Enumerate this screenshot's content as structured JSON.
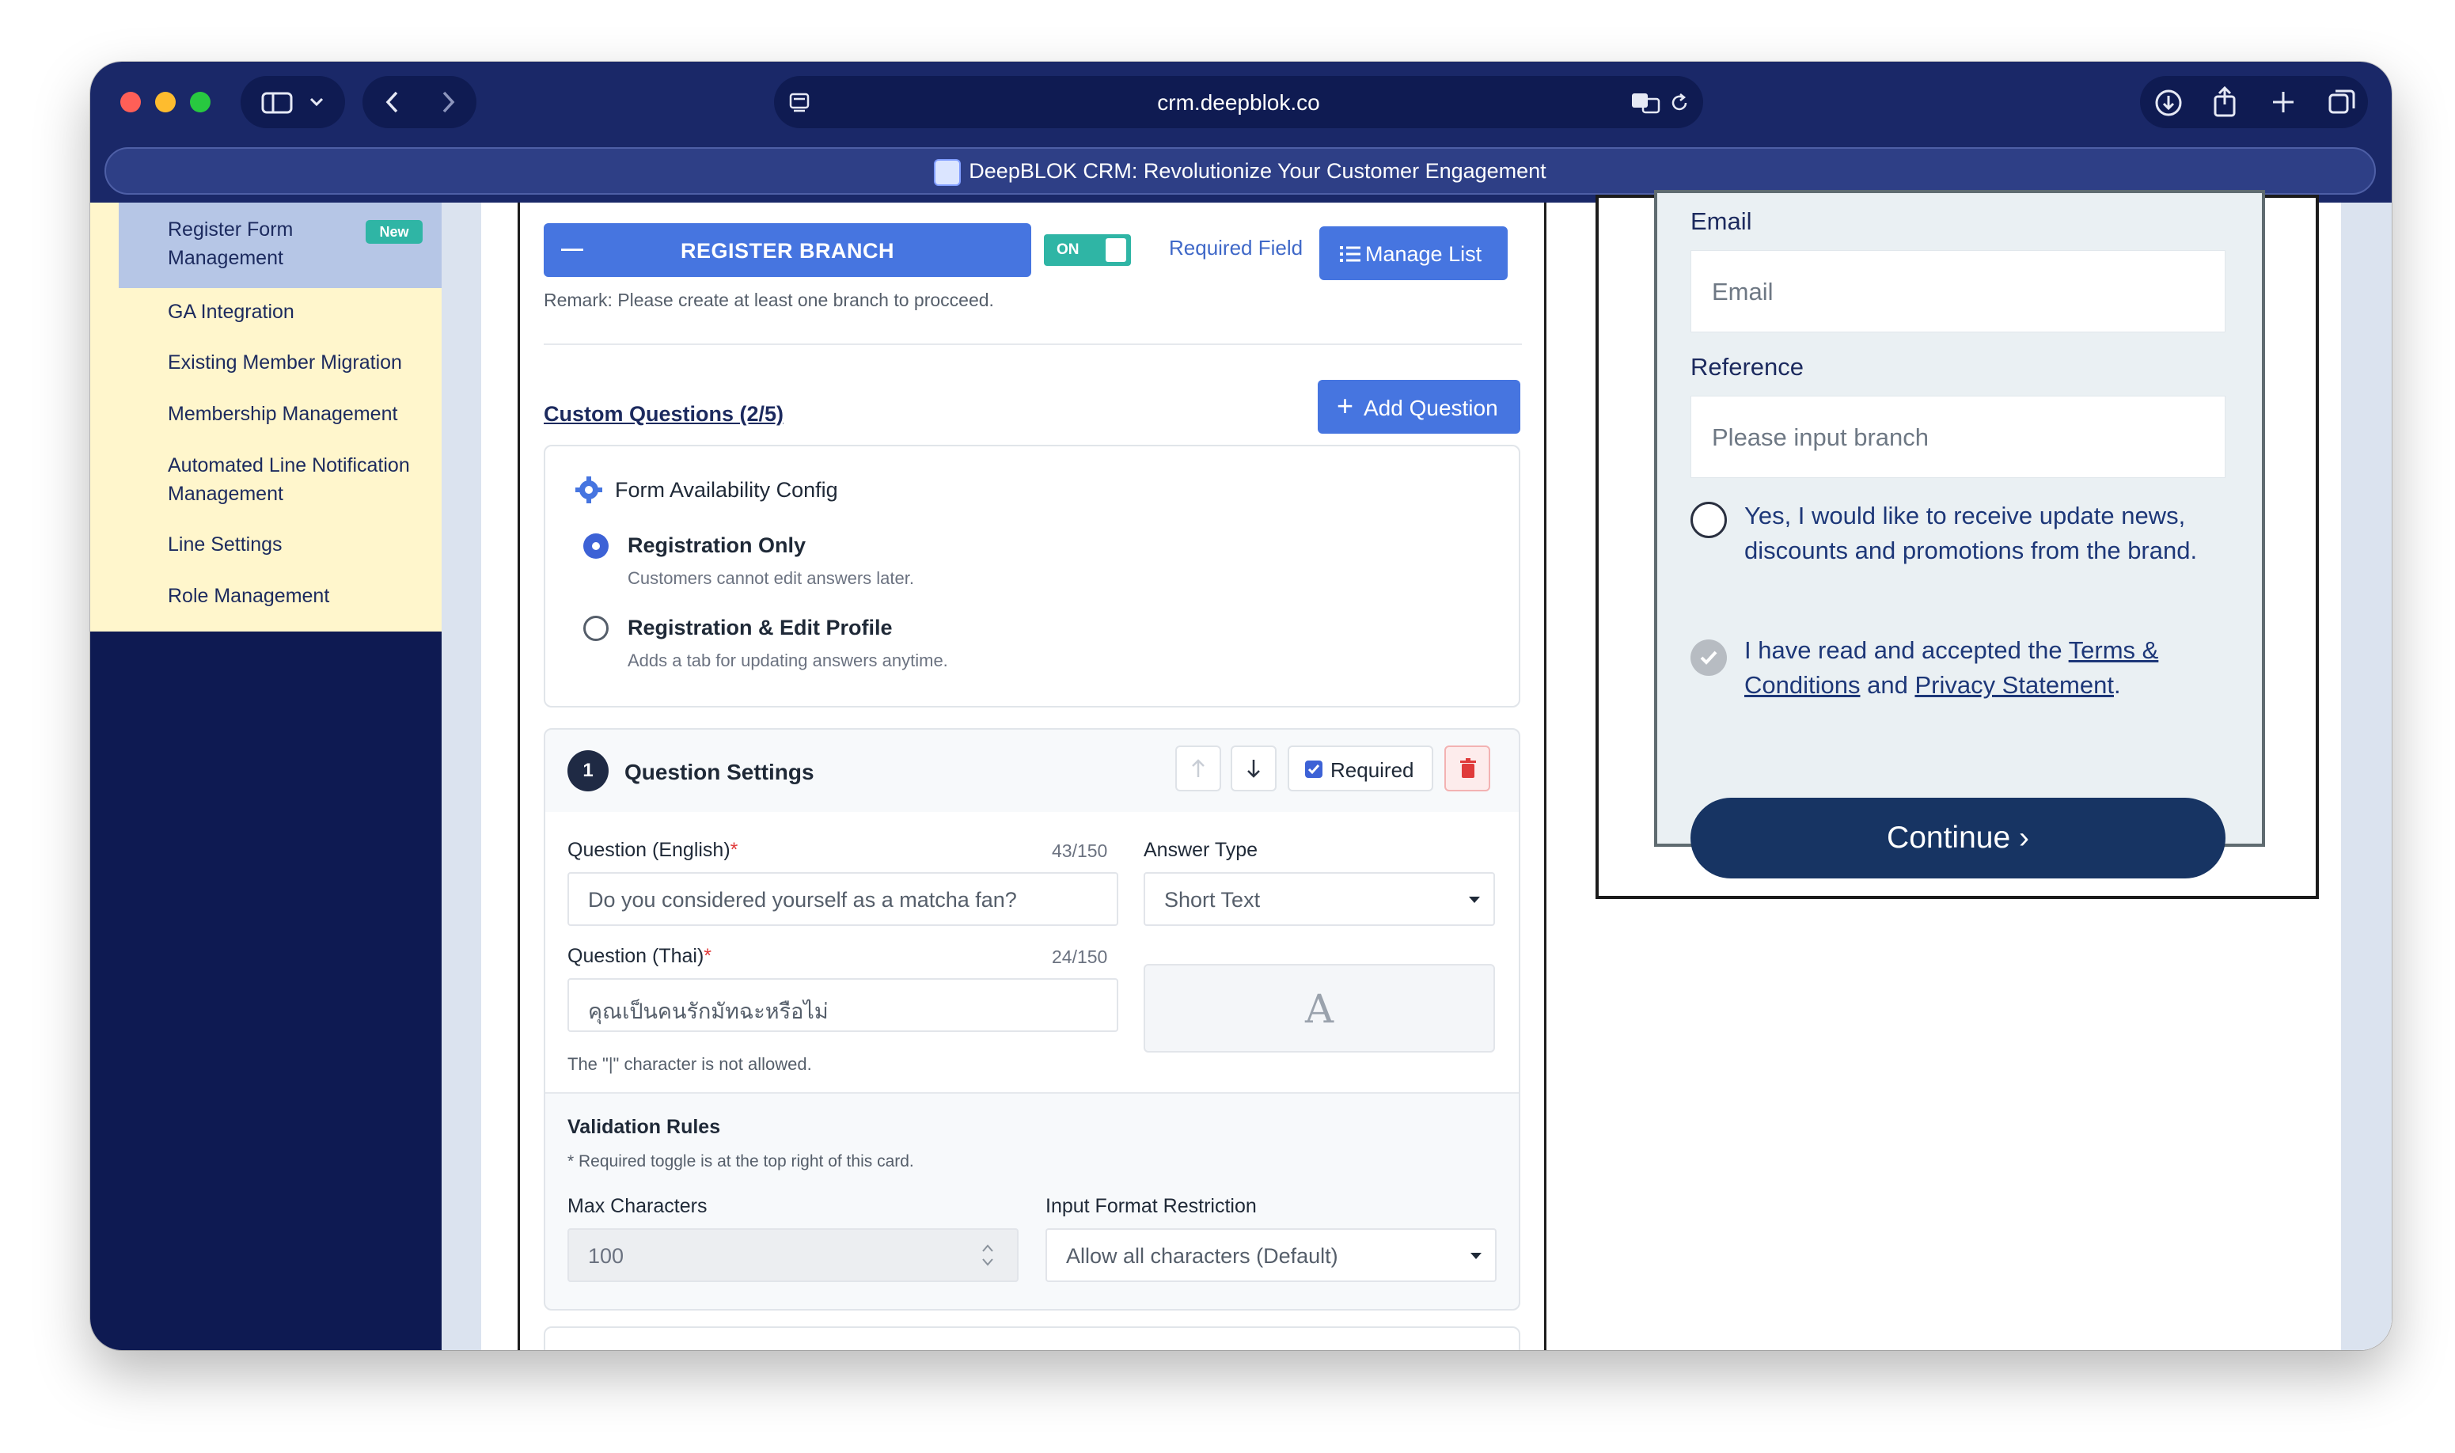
{
  "browser": {
    "url": "crm.deepblok.co",
    "tab_title": "DeepBLOK CRM: Revolutionize Your Customer Engagement"
  },
  "sidebar": {
    "items": [
      {
        "label": "Register Form Management",
        "badge": "New",
        "active": true
      },
      {
        "label": "GA Integration"
      },
      {
        "label": "Existing Member Migration"
      },
      {
        "label": "Membership Management"
      },
      {
        "label": "Automated Line Notification Management"
      },
      {
        "label": "Line Settings"
      },
      {
        "label": "Role Management"
      }
    ]
  },
  "branch": {
    "button_label": "REGISTER BRANCH",
    "collapse_symbol": "—",
    "toggle_label": "ON",
    "required_field_label": "Required Field",
    "manage_list_label": "Manage List",
    "remark": "Remark: Please create at least one branch to procceed."
  },
  "custom_questions": {
    "title": "Custom Questions (2/5)",
    "add_label": "Add Question"
  },
  "availability": {
    "title": "Form Availability Config",
    "options": [
      {
        "label": "Registration Only",
        "desc": "Customers cannot edit answers later.",
        "selected": true
      },
      {
        "label": "Registration & Edit Profile",
        "desc": "Adds a tab for updating answers anytime.",
        "selected": false
      }
    ]
  },
  "question": {
    "number": "1",
    "title": "Question Settings",
    "required_label": "Required",
    "english_label": "Question (English)",
    "english_count": "43/150",
    "english_value": "Do you considered yourself as a matcha fan?",
    "thai_label": "Question (Thai)",
    "thai_count": "24/150",
    "thai_value": "คุณเป็นคนรักมัทฉะหรือไม่",
    "answer_type_label": "Answer Type",
    "answer_type_value": "Short Text",
    "answer_type_icon_letter": "A",
    "pipe_note": "The \"|\" character is not allowed."
  },
  "validation": {
    "title": "Validation Rules",
    "note": "* Required toggle is at the top right of this card.",
    "max_label": "Max Characters",
    "max_value": "100",
    "format_label": "Input Format Restriction",
    "format_value": "Allow all characters (Default)"
  },
  "preview": {
    "email_label": "Email",
    "email_placeholder": "Email",
    "reference_label": "Reference",
    "reference_placeholder": "Please input branch",
    "news_consent": "Yes, I would like to receive update news, discounts and promotions from the brand.",
    "terms_prefix": "I have read and accepted the ",
    "terms_link": "Terms & Conditions",
    "terms_mid": " and ",
    "privacy_link": "Privacy Statement",
    "terms_suffix": ".",
    "continue_label": "Continue ›"
  },
  "colors": {
    "chrome": "#1a2868",
    "sidebar_dark": "#0e1a52",
    "sidebar_menu": "#fff6cc",
    "primary": "#4675e0",
    "toggle_on": "#2fb5a5",
    "continue": "#173463",
    "danger": "#e03b3b"
  }
}
